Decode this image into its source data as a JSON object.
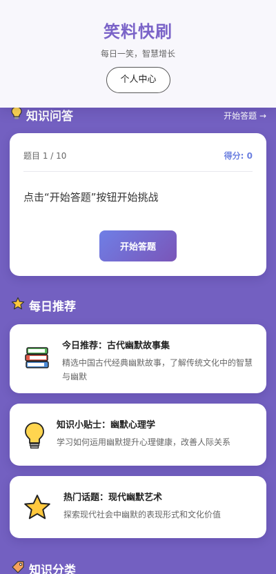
{
  "header": {
    "title": "笑料快刷",
    "subtitle": "每日一笑，智慧增长",
    "profile_button": "个人中心"
  },
  "quiz_section": {
    "title": "知识问答",
    "link": "开始答题 →",
    "question_counter": "题目 1 / 10",
    "score": "得分: 0",
    "prompt": "点击“开始答题”按钮开始挑战",
    "start_button": "开始答题"
  },
  "recommend_section": {
    "title": "每日推荐",
    "items": [
      {
        "icon": "books-icon",
        "title": "今日推荐：古代幽默故事集",
        "desc": "精选中国古代经典幽默故事，了解传统文化中的智慧与幽默"
      },
      {
        "icon": "lightbulb-icon",
        "title": "知识小贴士：幽默心理学",
        "desc": "学习如何运用幽默提升心理健康，改善人际关系"
      },
      {
        "icon": "star-icon",
        "title": "热门话题：现代幽默艺术",
        "desc": "探索现代社会中幽默的表现形式和文化价值"
      }
    ]
  },
  "category_section": {
    "title": "知识分类"
  }
}
